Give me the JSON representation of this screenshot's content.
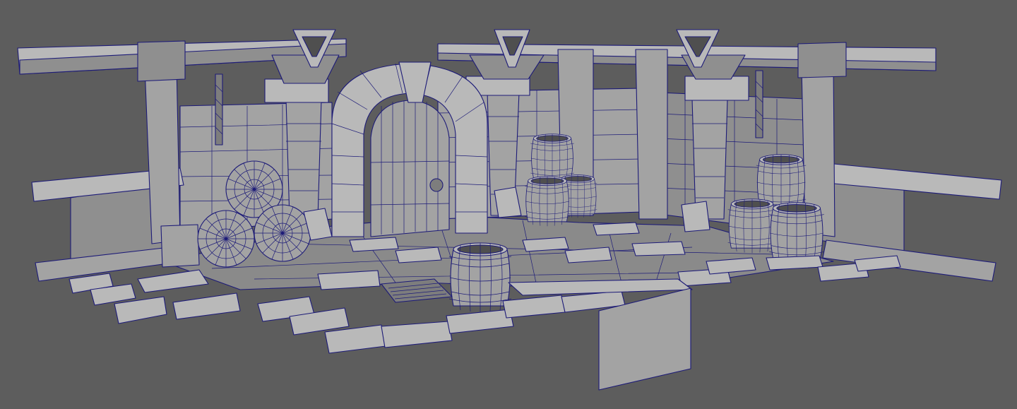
{
  "viewport": {
    "background": "#5d5d5d",
    "wireframe_color": "#1d1b78",
    "shaded_color": "#a3a3a3",
    "display_mode": "wireframe-on-shaded"
  },
  "scene": {
    "subject": "dungeon-room",
    "barrel_count": 11,
    "brazier_count": 3,
    "chain_count": 2,
    "door_count": 1
  }
}
